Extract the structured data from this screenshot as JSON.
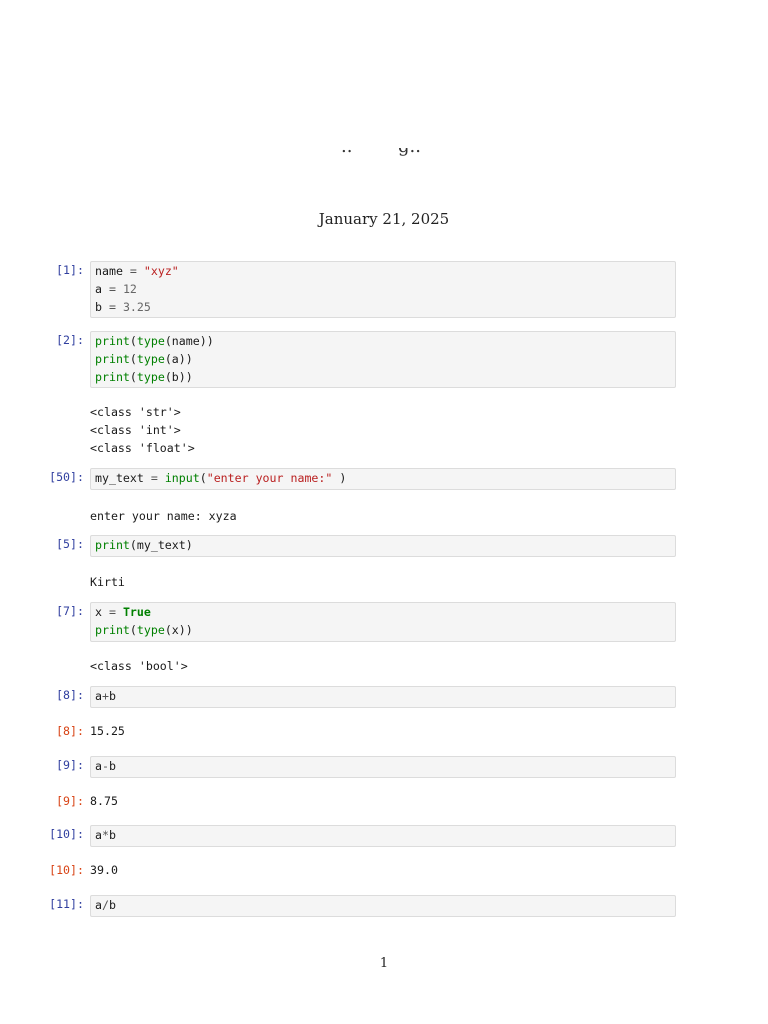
{
  "header": {
    "date": "January 21, 2025"
  },
  "cells": [
    {
      "prompt": "[1]:",
      "lines": [
        [
          {
            "t": "name",
            "c": "var"
          },
          {
            "t": " = ",
            "c": "op"
          },
          {
            "t": "\"xyz\"",
            "c": "str"
          }
        ],
        [
          {
            "t": "a",
            "c": "var"
          },
          {
            "t": " = ",
            "c": "op"
          },
          {
            "t": "12",
            "c": "num"
          }
        ],
        [
          {
            "t": "b",
            "c": "var"
          },
          {
            "t": " = ",
            "c": "op"
          },
          {
            "t": "3.25",
            "c": "num"
          }
        ]
      ],
      "stream": [],
      "result": null
    },
    {
      "prompt": "[2]:",
      "lines": [
        [
          {
            "t": "print",
            "c": "builtin"
          },
          {
            "t": "(",
            "c": "plain"
          },
          {
            "t": "type",
            "c": "builtin"
          },
          {
            "t": "(name))",
            "c": "plain"
          }
        ],
        [
          {
            "t": "print",
            "c": "builtin"
          },
          {
            "t": "(",
            "c": "plain"
          },
          {
            "t": "type",
            "c": "builtin"
          },
          {
            "t": "(a))",
            "c": "plain"
          }
        ],
        [
          {
            "t": "print",
            "c": "builtin"
          },
          {
            "t": "(",
            "c": "plain"
          },
          {
            "t": "type",
            "c": "builtin"
          },
          {
            "t": "(b))",
            "c": "plain"
          }
        ]
      ],
      "stream": [
        "<class 'str'>",
        "<class 'int'>",
        "<class 'float'>"
      ],
      "result": null
    },
    {
      "prompt": "[50]:",
      "lines": [
        [
          {
            "t": "my_text",
            "c": "var"
          },
          {
            "t": " = ",
            "c": "op"
          },
          {
            "t": "input",
            "c": "builtin"
          },
          {
            "t": "(",
            "c": "plain"
          },
          {
            "t": "\"enter your name:\"",
            "c": "str"
          },
          {
            "t": " )",
            "c": "plain"
          }
        ]
      ],
      "stream": [
        "enter your name: xyza"
      ],
      "result": null
    },
    {
      "prompt": "[5]:",
      "lines": [
        [
          {
            "t": "print",
            "c": "builtin"
          },
          {
            "t": "(my_text)",
            "c": "plain"
          }
        ]
      ],
      "stream": [
        "Kirti"
      ],
      "result": null
    },
    {
      "prompt": "[7]:",
      "lines": [
        [
          {
            "t": "x",
            "c": "var"
          },
          {
            "t": " = ",
            "c": "op"
          },
          {
            "t": "True",
            "c": "kw"
          }
        ],
        [
          {
            "t": "print",
            "c": "builtin"
          },
          {
            "t": "(",
            "c": "plain"
          },
          {
            "t": "type",
            "c": "builtin"
          },
          {
            "t": "(x))",
            "c": "plain"
          }
        ]
      ],
      "stream": [
        "<class 'bool'>"
      ],
      "result": null
    },
    {
      "prompt": "[8]:",
      "lines": [
        [
          {
            "t": "a",
            "c": "var"
          },
          {
            "t": "+",
            "c": "op"
          },
          {
            "t": "b",
            "c": "var"
          }
        ]
      ],
      "stream": [],
      "result": {
        "prompt": "[8]:",
        "value": "15.25"
      }
    },
    {
      "prompt": "[9]:",
      "lines": [
        [
          {
            "t": "a",
            "c": "var"
          },
          {
            "t": "-",
            "c": "op"
          },
          {
            "t": "b",
            "c": "var"
          }
        ]
      ],
      "stream": [],
      "result": {
        "prompt": "[9]:",
        "value": "8.75"
      }
    },
    {
      "prompt": "[10]:",
      "lines": [
        [
          {
            "t": "a",
            "c": "var"
          },
          {
            "t": "*",
            "c": "op"
          },
          {
            "t": "b",
            "c": "var"
          }
        ]
      ],
      "stream": [],
      "result": {
        "prompt": "[10]:",
        "value": "39.0"
      }
    },
    {
      "prompt": "[11]:",
      "lines": [
        [
          {
            "t": "a",
            "c": "var"
          },
          {
            "t": "/",
            "c": "op"
          },
          {
            "t": "b",
            "c": "var"
          }
        ]
      ],
      "stream": [],
      "result": null
    }
  ],
  "footer": {
    "page_number": "1"
  }
}
